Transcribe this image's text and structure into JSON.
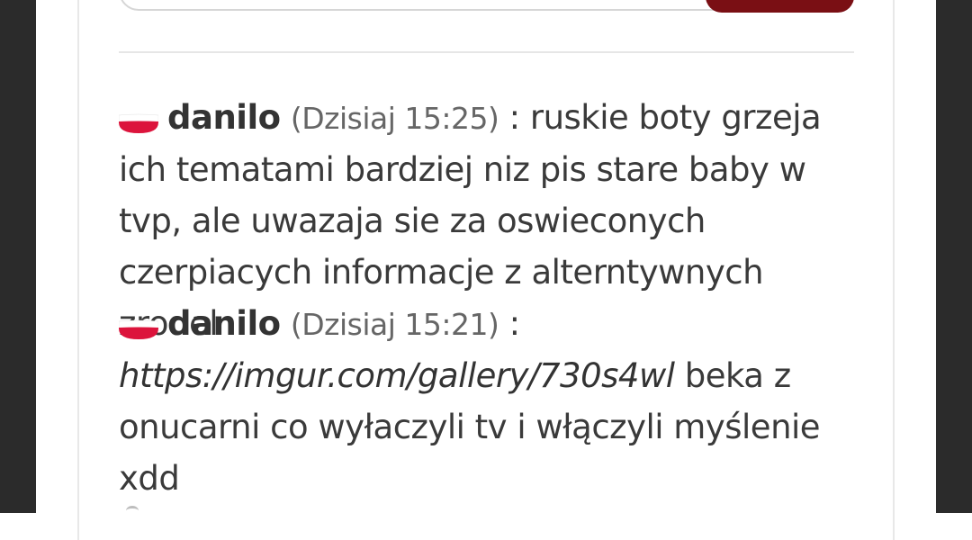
{
  "chat": {
    "messages": [
      {
        "author": "danilo",
        "flag": "poland-flag",
        "time": "(Dzisiaj 15:25)",
        "separator": " : ",
        "text": "ruskie boty grzeja ich tematami bardziej niz pis stare baby w tvp, ale uwazaja sie za oswieconych czerpiacych informacje z alterntywnych zrodel"
      },
      {
        "author": "danilo",
        "flag": "poland-flag",
        "time": "(Dzisiaj 15:21)",
        "separator": " :",
        "link": "https://imgur.com/gallery/730s4wl",
        "text": " beka z onucarni co wyłaczyli tv i włączyli myślenie xdd"
      }
    ]
  },
  "colors": {
    "flag_red": "#dc143c",
    "flag_white": "#ffffff",
    "send_button": "#7a0f14",
    "side_edges": "#2b2b2b"
  }
}
